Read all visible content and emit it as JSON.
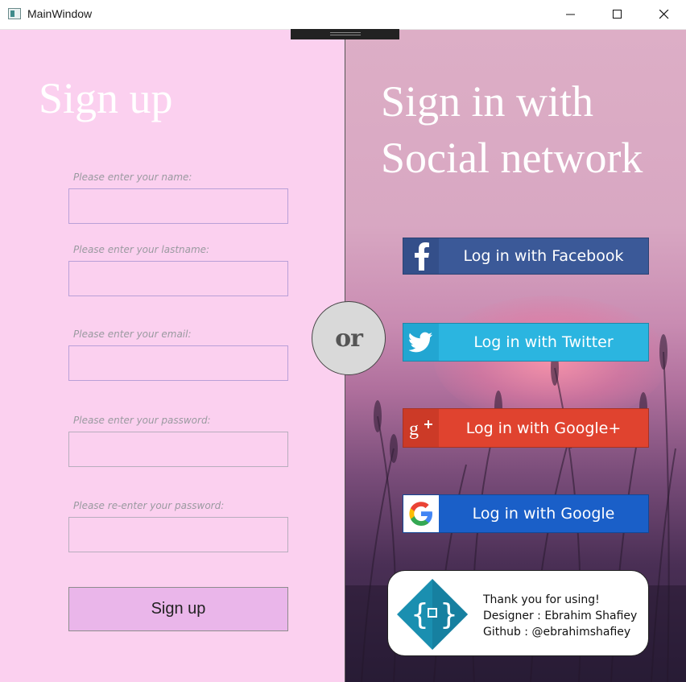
{
  "window": {
    "title": "MainWindow"
  },
  "signup": {
    "title": "Sign up",
    "fields": [
      {
        "label": "Please enter your name:",
        "value": ""
      },
      {
        "label": "Please enter your lastname:",
        "value": ""
      },
      {
        "label": "Please enter your email:",
        "value": ""
      },
      {
        "label": "Please enter your password:",
        "value": ""
      },
      {
        "label": "Please re-enter your password:",
        "value": ""
      }
    ],
    "button_label": "Sign up"
  },
  "separator": {
    "text": "or"
  },
  "social": {
    "title_line1": "Sign in with",
    "title_line2": "Social network",
    "buttons": [
      {
        "label": "Log in with Facebook",
        "icon": "facebook-icon",
        "color": "#3b5998"
      },
      {
        "label": "Log in with Twitter",
        "icon": "twitter-icon",
        "color": "#2bb5e0"
      },
      {
        "label": "Log in with Google+",
        "icon": "google-plus-icon",
        "color": "#e0432f"
      },
      {
        "label": "Log in with Google",
        "icon": "google-icon",
        "color": "#1a5fc8"
      }
    ]
  },
  "credit": {
    "line1": "Thank you for using!",
    "line2": "Designer : Ebrahim Shafiey",
    "line3": "Github : @ebrahimshafiey",
    "logo_icon": "code-diamond-logo"
  },
  "colors": {
    "left_bg": "#fbd0ef",
    "signup_button": "#eab6ea",
    "field_border": "#b9a0d8"
  }
}
